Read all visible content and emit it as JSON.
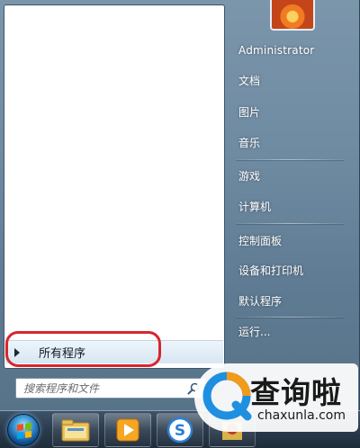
{
  "user": {
    "name": "Administrator"
  },
  "right_menu": [
    "文档",
    "图片",
    "音乐",
    "游戏",
    "计算机",
    "控制面板",
    "设备和打印机",
    "默认程序",
    "运行..."
  ],
  "left_menu": {
    "all_programs_label": "所有程序"
  },
  "search": {
    "placeholder": "搜索程序和文件"
  },
  "taskbar": {
    "buttons": [
      "start-orb",
      "file-explorer-icon",
      "media-player-icon",
      "sogou-input-icon",
      "app-icon"
    ]
  },
  "watermark": {
    "cn": "查询啦",
    "en": "chaxunla.com"
  },
  "colors": {
    "highlight": "#d7262e",
    "watermark_blue": "#1f8fe0",
    "watermark_orange": "#f29a1a"
  }
}
